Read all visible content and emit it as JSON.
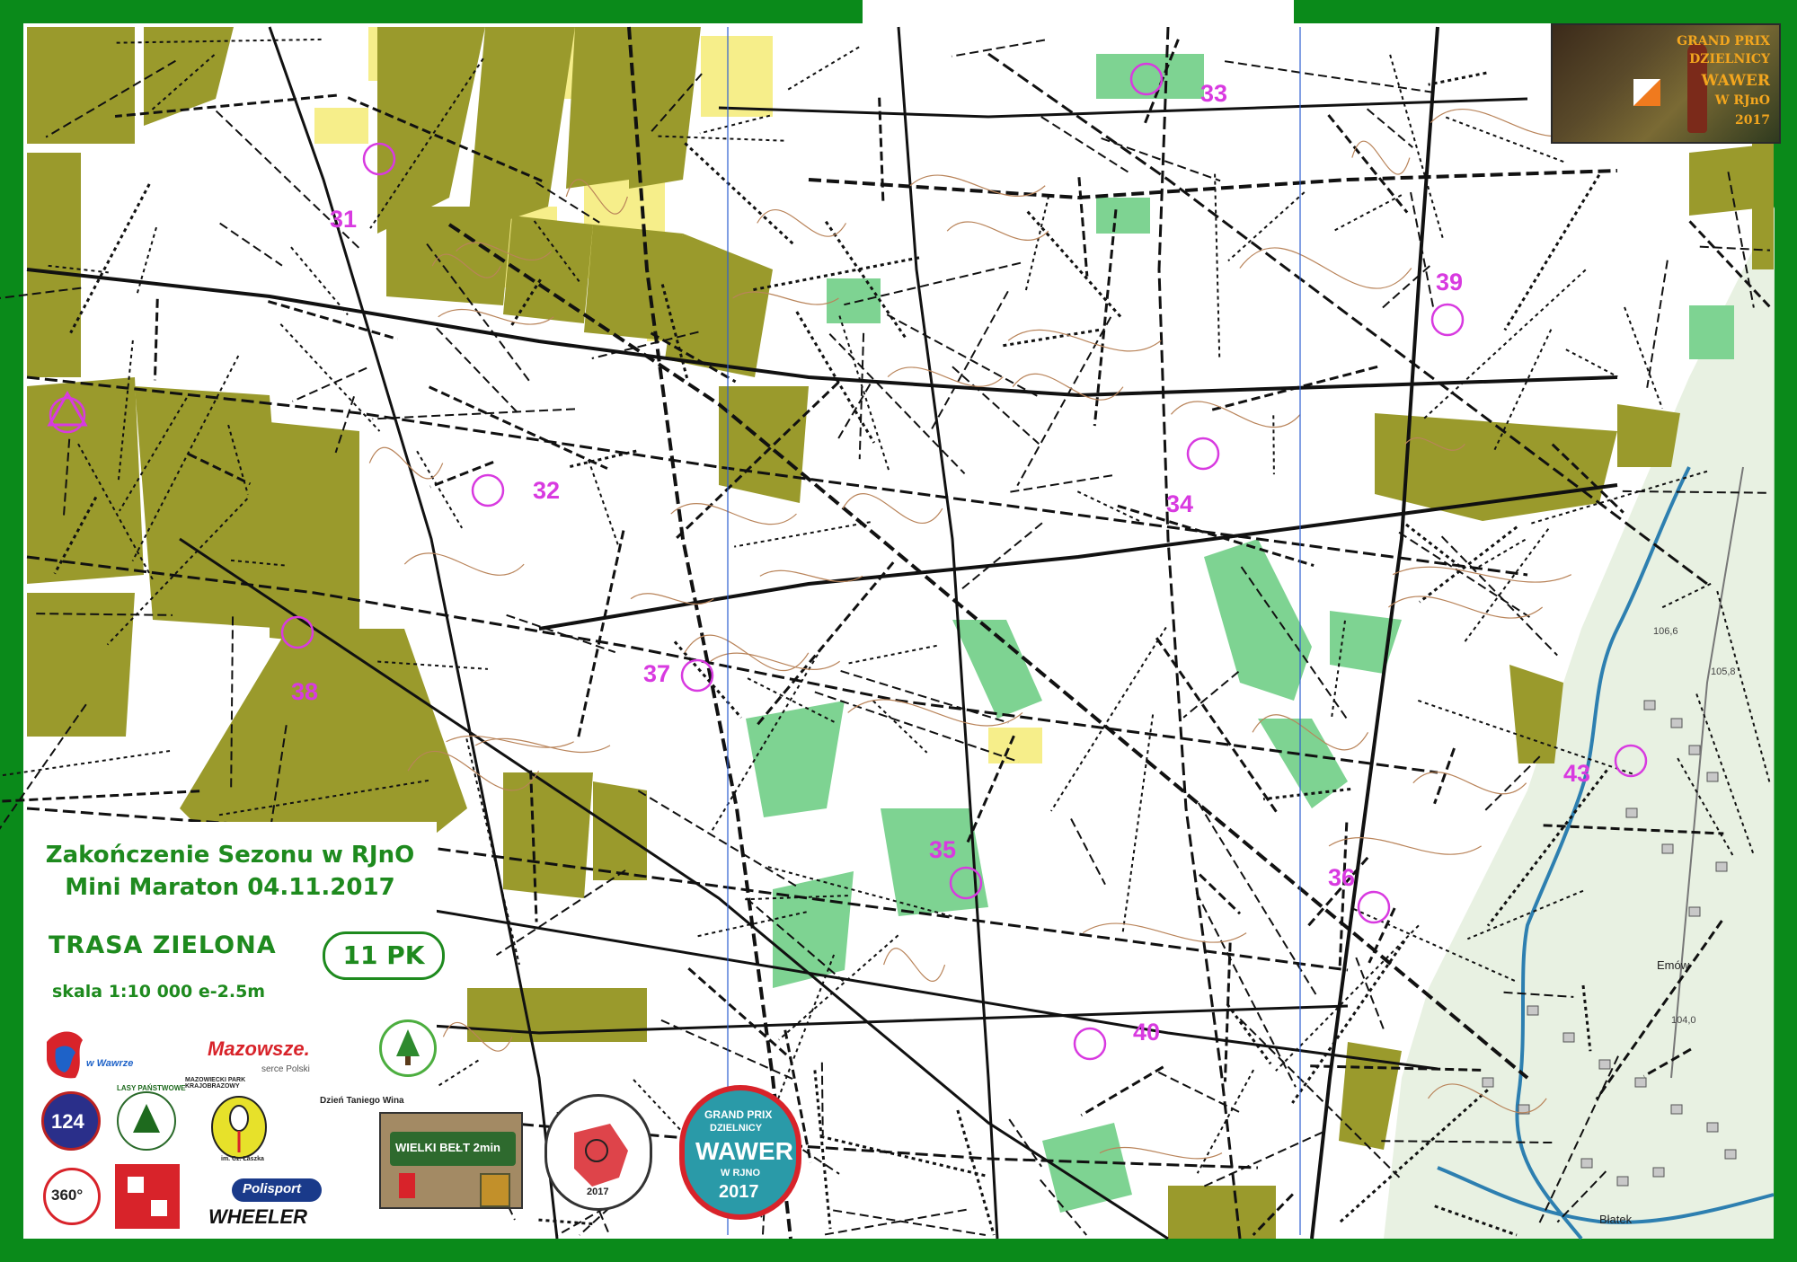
{
  "map": {
    "legend": {
      "title_line1": "Zakończenie Sezonu w RJnO",
      "title_line2": "Mini Maraton   04.11.2017",
      "route": "TRASA  ZIELONA",
      "control_count": "11 PK",
      "scale": "skala 1:10 000   e-2.5m"
    },
    "controls": [
      {
        "label": "31"
      },
      {
        "label": "32"
      },
      {
        "label": "33"
      },
      {
        "label": "34"
      },
      {
        "label": "35"
      },
      {
        "label": "36"
      },
      {
        "label": "37"
      },
      {
        "label": "38"
      },
      {
        "label": "39"
      },
      {
        "label": "40"
      },
      {
        "label": "43"
      }
    ],
    "topo_labels": [
      "Emów",
      "Błatek",
      "104,0",
      "106,6",
      "105,8"
    ],
    "colors": {
      "frame": "#0a8a1a",
      "forest_olive": "#9a9a2c",
      "open_yellow": "#f6ee8a",
      "green_veg": "#7ed392",
      "course_magenta": "#d83ae0",
      "track_black": "#111111",
      "topo_tint": "#e8f1e2"
    }
  },
  "logos": {
    "grand_prix_photo": {
      "line1": "GRAND PRIX",
      "line2": "DZIELNICY",
      "line3": "WAWER",
      "line4": "W RJnO",
      "line5": "2017"
    },
    "mazowsze": "Mazowsze.",
    "mazowsze_sub": "serce Polski",
    "wawer_city": "w Wawrze",
    "lasy": "LASY PAŃSTWOWE",
    "mpk": "MAZOWIECKI PARK KRAJOBRAZOWY",
    "mpk_sub": "im. Cz. Łaszka",
    "zpk": "Zielony Punkt Kontrolny",
    "wine_caption": "Dzień Taniego Wina",
    "wine_sign": "WIELKI BEŁT 2min",
    "bike_cup_year": "2017",
    "gp_wawer": {
      "line1": "GRAND PRIX",
      "line2": "DZIELNICY",
      "line3": "WAWER",
      "line4": "W RJNO",
      "line5": "2017"
    },
    "polisport": "Polisport",
    "wheeler": "WHEELER",
    "badge_124": "124",
    "badge_360": "360°"
  }
}
